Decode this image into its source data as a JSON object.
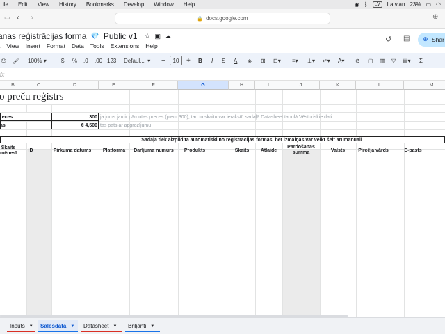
{
  "mac_menu": {
    "items": [
      "ile",
      "Edit",
      "View",
      "History",
      "Bookmarks",
      "Develop",
      "Window",
      "Help"
    ],
    "input_source": "LV",
    "language": "Latvian",
    "battery": "23%"
  },
  "browser": {
    "url": "docs.google.com"
  },
  "doc": {
    "title": "anas reģistrācijas forma",
    "title_suffix": "Public v1",
    "menus": [
      "t",
      "View",
      "Insert",
      "Format",
      "Data",
      "Tools",
      "Extensions",
      "Help"
    ],
    "share_label": "Shar"
  },
  "toolbar": {
    "zoom": "100%",
    "currency": "$",
    "percent": "%",
    "decrease_decimal": ".0",
    "increase_decimal": ".00",
    "number_format": "123",
    "font": "Defaul...",
    "font_size": "10",
    "bold": "B",
    "italic": "I",
    "text_color": "A",
    "sum": "Σ"
  },
  "formula_bar": {
    "fx": "fx"
  },
  "sheet": {
    "columns": [
      "B",
      "C",
      "D",
      "E",
      "F",
      "G",
      "H",
      "I",
      "J",
      "K",
      "L",
      "M"
    ],
    "selected_column": "G",
    "title": "o preču reģistrs",
    "inputs": [
      {
        "label": "reces",
        "value": "300",
        "note": "ja jums jau ir pārdotas preces (piem.300), tad to skaitu var ierakstīt sadaļā Datasheet tabulā Vēsturiskie dati"
      },
      {
        "label": "as",
        "value": "€ 4,500",
        "note": "tas pats ar apgrozījumu"
      }
    ],
    "banner": "Sadaļa tiek aizpildīta automātiski no reģistrācijas formas, bet izmaiņas var veikt šeit arī manuāli",
    "headers": [
      "Skaits mēnesī",
      "ID",
      "Pirkuma datums",
      "Platforma",
      "Darījuma numurs",
      "Produkts",
      "Skaits",
      "Atlaide",
      "Pārdošanas summa",
      "Valsts",
      "Pircēja vārds",
      "E-pasts"
    ]
  },
  "tabs": [
    {
      "label": "Inputs",
      "color": "#d93025"
    },
    {
      "label": "Salesdata",
      "color": "#1a73e8",
      "active": true
    },
    {
      "label": "Datasheet",
      "color": "#d93025"
    },
    {
      "label": "Briljanti",
      "color": "#1a73e8"
    }
  ]
}
